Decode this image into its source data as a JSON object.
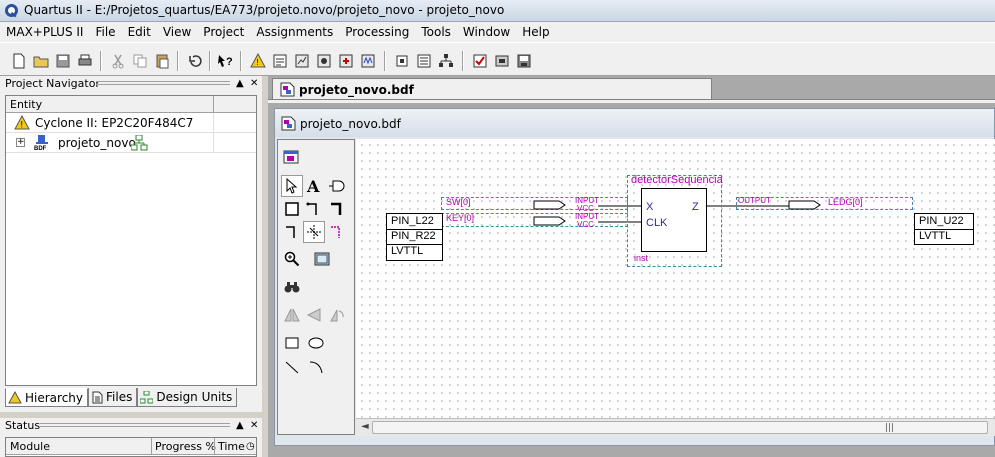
{
  "window": {
    "title": "Quartus II - E:/Projetos_quartus/EA773/projeto.novo/projeto_novo - projeto_novo"
  },
  "menu": [
    "MAX+PLUS II",
    "File",
    "Edit",
    "View",
    "Project",
    "Assignments",
    "Processing",
    "Tools",
    "Window",
    "Help"
  ],
  "navigator": {
    "title": "Project Navigator",
    "column": "Entity",
    "rows": [
      "Cyclone II: EP2C20F484C7",
      "projeto_novo"
    ],
    "tabs": [
      "Hierarchy",
      "Files",
      "Design Units"
    ]
  },
  "status": {
    "title": "Status",
    "columns": [
      "Module",
      "Progress %",
      "Time"
    ]
  },
  "document": {
    "tab_label": "projeto_novo.bdf",
    "window_title": "projeto_novo.bdf"
  },
  "schematic": {
    "input_pin_1": {
      "name": "SW[0]",
      "type": "INPUT",
      "default": "VCC"
    },
    "input_pin_2": {
      "name": "KEY[0]",
      "type": "INPUT",
      "default": "VCC"
    },
    "input_assign_box": [
      "PIN_L22",
      "PIN_R22",
      "LVTTL"
    ],
    "block": {
      "name": "detectorSequencia",
      "inputs": [
        "X",
        "CLK"
      ],
      "output": "Z",
      "instance": "inst"
    },
    "output_pin": {
      "name": "LEDG[0]",
      "type": "OUTPUT"
    },
    "output_assign_box": [
      "PIN_U22",
      "LVTTL"
    ]
  },
  "colors": {
    "schematic_accent": "#b000b0",
    "warning": "#f2c81f"
  }
}
